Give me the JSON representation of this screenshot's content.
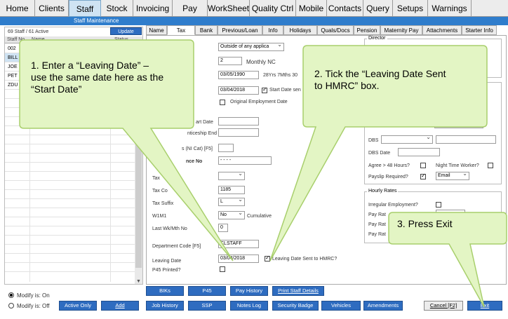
{
  "menu": [
    "Home",
    "Clients",
    "Staff",
    "Stock",
    "Invoicing",
    "Pay",
    "WorkSheet",
    "Quality Ctrl",
    "Mobile",
    "Contacts",
    "Query",
    "Setups",
    "Warnings"
  ],
  "window_title": "Staff Maintenance",
  "staff_count": "69 Staff / 61 Active",
  "update_label": "Update",
  "grid_headers": {
    "staff_no": "Staff No.",
    "name": "Name",
    "status": "Status"
  },
  "grid_rows": [
    "002",
    "BILL",
    "JOE",
    "PET",
    "ZDU"
  ],
  "tabs": [
    "Name",
    "Tax",
    "Bank",
    "Previous/Loan",
    "Info",
    "Holidays",
    "Quals/Docs",
    "Pension",
    "Maternity Pay",
    "Attachments",
    "Starter Info"
  ],
  "tax": {
    "ir35": "Outside of any applica",
    "pay_number": "2",
    "pay_freq": "Monthly NC",
    "dob": "03/05/1990",
    "age": "28Yrs 7Mths 30",
    "start_date": "03/04/2018",
    "start_date_sent": "Start Date sen",
    "original_employment": "Original Employment Date",
    "label_start_date": "art Date",
    "label_apprenticeship": "nticeship End Date",
    "label_ni_cat": "s (NI Cat) [F5]",
    "label_ni_no": "nce No",
    "ni_no": "- - - -",
    "label_tax": "Tax",
    "label_tax_code": "Tax Co",
    "tax_code": "1185",
    "label_tax_suffix": "Tax Suffix",
    "tax_suffix": "L",
    "label_w1m1": "W1M1",
    "w1m1": "No",
    "cumulative": "Cumulative",
    "label_last_wk": "Last Wk/Mth No",
    "last_wk": "0",
    "label_dept": "Department Code [F5]",
    "dept": "CLSTAFF",
    "label_leaving": "Leaving Date",
    "leaving_date": "03/04/2018",
    "leaving_sent": "Leaving Date Sent to HMRC?",
    "label_p45": "P45 Printed?"
  },
  "right": {
    "director": "Director",
    "dbs": "DBS",
    "dbs_date": "DBS Date",
    "agree48": "Agree > 48 Hours?",
    "night_worker": "Night Time Worker?",
    "payslip_req": "Payslip Required?",
    "payslip_method": "Email",
    "hourly_rates": "Hourly Rates",
    "irregular": "Irregular Employment?",
    "pay_rate_1": "Pay Rat",
    "pay_rate_2": "Pay Rat",
    "pay_rate_3": "Pay Rat"
  },
  "bottom": {
    "modify_on": "Modify is: On",
    "modify_off": "Modify is: Off",
    "active_only": "Active Only",
    "add": "Add",
    "biks": "BIKs",
    "p45": "P45",
    "pay_history": "Pay History",
    "print_staff": "Print Staff Details",
    "job_history": "Job History",
    "ssp": "SSP",
    "notes_log": "Notes Log",
    "security_badge": "Security Badge",
    "vehicles": "Vehicles",
    "amendments": "Amendments",
    "cancel": "Cancel [F2]",
    "exit": "Exit"
  },
  "callouts": {
    "c1_l1": "1. Enter a “Leaving Date” –",
    "c1_l2": "use the same date here as the",
    "c1_l3": "“Start Date”",
    "c2_l1": "2. Tick the “Leaving Date Sent",
    "c2_l2": "to HMRC” box.",
    "c3": "3. Press Exit"
  },
  "colors": {
    "accent": "#2e6cc0",
    "callout_fill": "#e3f5c4",
    "callout_border": "#a8cf6c",
    "titlebar": "#2f7dcc"
  }
}
